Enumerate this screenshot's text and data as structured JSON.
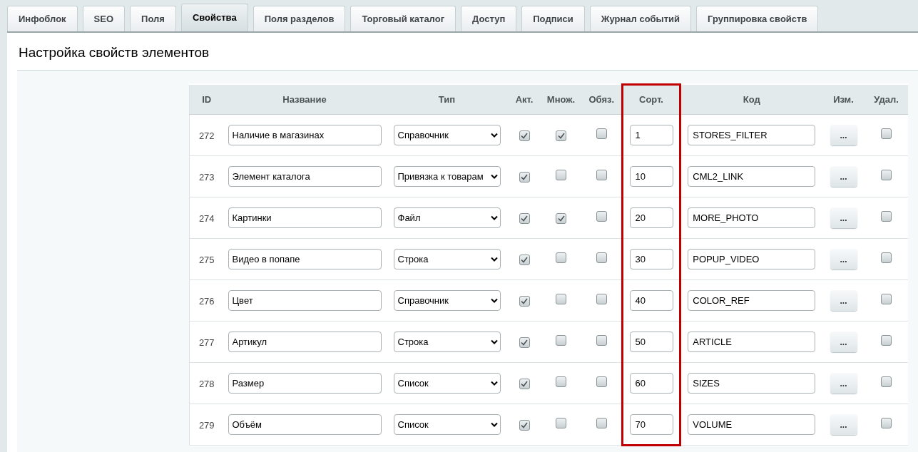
{
  "tabs": [
    {
      "label": "Инфоблок",
      "selected": false
    },
    {
      "label": "SEO",
      "selected": false
    },
    {
      "label": "Поля",
      "selected": false
    },
    {
      "label": "Свойства",
      "selected": true
    },
    {
      "label": "Поля разделов",
      "selected": false
    },
    {
      "label": "Торговый каталог",
      "selected": false
    },
    {
      "label": "Доступ",
      "selected": false
    },
    {
      "label": "Подписи",
      "selected": false
    },
    {
      "label": "Журнал событий",
      "selected": false
    },
    {
      "label": "Группировка свойств",
      "selected": false
    }
  ],
  "title": "Настройка свойств элементов",
  "table": {
    "columns": [
      {
        "label": "ID",
        "highlighted": false
      },
      {
        "label": "Название",
        "highlighted": false
      },
      {
        "label": "Тип",
        "highlighted": false
      },
      {
        "label": "Акт.",
        "highlighted": false
      },
      {
        "label": "Множ.",
        "highlighted": false
      },
      {
        "label": "Обяз.",
        "highlighted": false
      },
      {
        "label": "Сорт.",
        "highlighted": true
      },
      {
        "label": "Код",
        "highlighted": false
      },
      {
        "label": "Изм.",
        "highlighted": false
      },
      {
        "label": "Удал.",
        "highlighted": false
      }
    ],
    "rows": [
      {
        "id": "272",
        "name": "Наличие в магазинах",
        "type": "Справочник",
        "active": true,
        "multiple": true,
        "required": false,
        "sort": "1",
        "code": "STORES_FILTER",
        "edit": "...",
        "delete": false
      },
      {
        "id": "273",
        "name": "Элемент каталога",
        "type": "Привязка к товарам",
        "active": true,
        "multiple": false,
        "required": false,
        "sort": "10",
        "code": "CML2_LINK",
        "edit": "...",
        "delete": false
      },
      {
        "id": "274",
        "name": "Картинки",
        "type": "Файл",
        "active": true,
        "multiple": true,
        "required": false,
        "sort": "20",
        "code": "MORE_PHOTO",
        "edit": "...",
        "delete": false
      },
      {
        "id": "275",
        "name": "Видео в попапе",
        "type": "Строка",
        "active": true,
        "multiple": false,
        "required": false,
        "sort": "30",
        "code": "POPUP_VIDEO",
        "edit": "...",
        "delete": false
      },
      {
        "id": "276",
        "name": "Цвет",
        "type": "Справочник",
        "active": true,
        "multiple": false,
        "required": false,
        "sort": "40",
        "code": "COLOR_REF",
        "edit": "...",
        "delete": false
      },
      {
        "id": "277",
        "name": "Артикул",
        "type": "Строка",
        "active": true,
        "multiple": false,
        "required": false,
        "sort": "50",
        "code": "ARTICLE",
        "edit": "...",
        "delete": false
      },
      {
        "id": "278",
        "name": "Размер",
        "type": "Список",
        "active": true,
        "multiple": false,
        "required": false,
        "sort": "60",
        "code": "SIZES",
        "edit": "...",
        "delete": false
      },
      {
        "id": "279",
        "name": "Объём",
        "type": "Список",
        "active": true,
        "multiple": false,
        "required": false,
        "sort": "70",
        "code": "VOLUME",
        "edit": "...",
        "delete": false
      }
    ]
  }
}
